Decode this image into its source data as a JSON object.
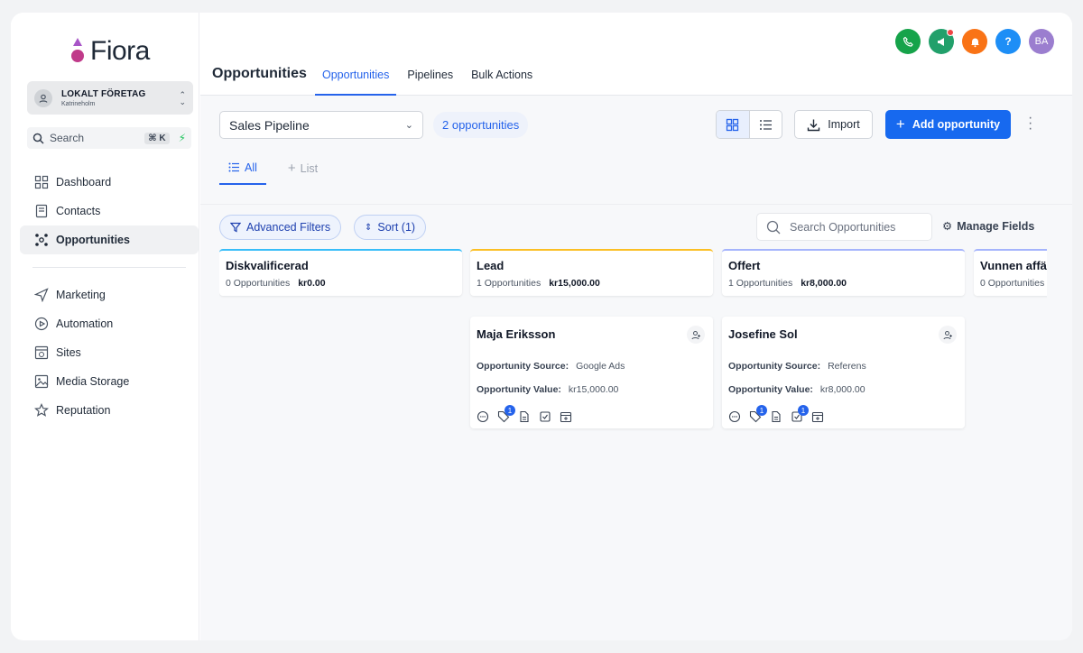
{
  "app": {
    "logo_text": "Fiora"
  },
  "org": {
    "name": "LOKALT FÖRETAG",
    "city": "Katrineholm"
  },
  "search": {
    "label": "Search",
    "shortcut": "⌘ K"
  },
  "nav": {
    "items": [
      {
        "label": "Dashboard",
        "icon": "dashboard-icon"
      },
      {
        "label": "Contacts",
        "icon": "contacts-icon"
      },
      {
        "label": "Opportunities",
        "icon": "opportunities-icon",
        "active": true
      }
    ],
    "items2": [
      {
        "label": "Marketing",
        "icon": "send-icon"
      },
      {
        "label": "Automation",
        "icon": "play-icon"
      },
      {
        "label": "Sites",
        "icon": "globe-icon"
      },
      {
        "label": "Media Storage",
        "icon": "image-icon"
      },
      {
        "label": "Reputation",
        "icon": "star-icon"
      }
    ]
  },
  "header": {
    "title": "Opportunities",
    "tabs": [
      "Opportunities",
      "Pipelines",
      "Bulk Actions"
    ],
    "avatar": "BA"
  },
  "colors": {
    "accent": "#1769ef",
    "phone": "#16a34a",
    "megaphone": "#22a06b",
    "bell": "#f97316",
    "help": "#1d8ef6",
    "avatar": "#9b7ecf"
  },
  "toolbar": {
    "pipeline": "Sales Pipeline",
    "count": "2 opportunities",
    "import": "Import",
    "add": "Add opportunity"
  },
  "subtabs": [
    "All",
    "List"
  ],
  "filters": {
    "advanced": "Advanced Filters",
    "sort": "Sort (1)",
    "search_placeholder": "Search Opportunities",
    "manage": "Manage Fields"
  },
  "columns": [
    {
      "title": "Diskvalificerad",
      "count": "0 Opportunities",
      "amount": "kr0.00",
      "color": "#38bdf8"
    },
    {
      "title": "Lead",
      "count": "1 Opportunities",
      "amount": "kr15,000.00",
      "color": "#fbbf24"
    },
    {
      "title": "Offert",
      "count": "1 Opportunities",
      "amount": "kr8,000.00",
      "color": "#a5b4fc"
    },
    {
      "title": "Vunnen affä",
      "count": "0 Opportunities",
      "amount": "",
      "color": "#a5b4fc"
    }
  ],
  "cards": [
    {
      "name": "Maja Eriksson",
      "source_label": "Opportunity Source:",
      "source": "Google Ads",
      "value_label": "Opportunity Value:",
      "value": "kr15,000.00",
      "tag_count": "1",
      "task_count": ""
    },
    {
      "name": "Josefine Sol",
      "source_label": "Opportunity Source:",
      "source": "Referens",
      "value_label": "Opportunity Value:",
      "value": "kr8,000.00",
      "tag_count": "1",
      "task_count": "1"
    }
  ]
}
